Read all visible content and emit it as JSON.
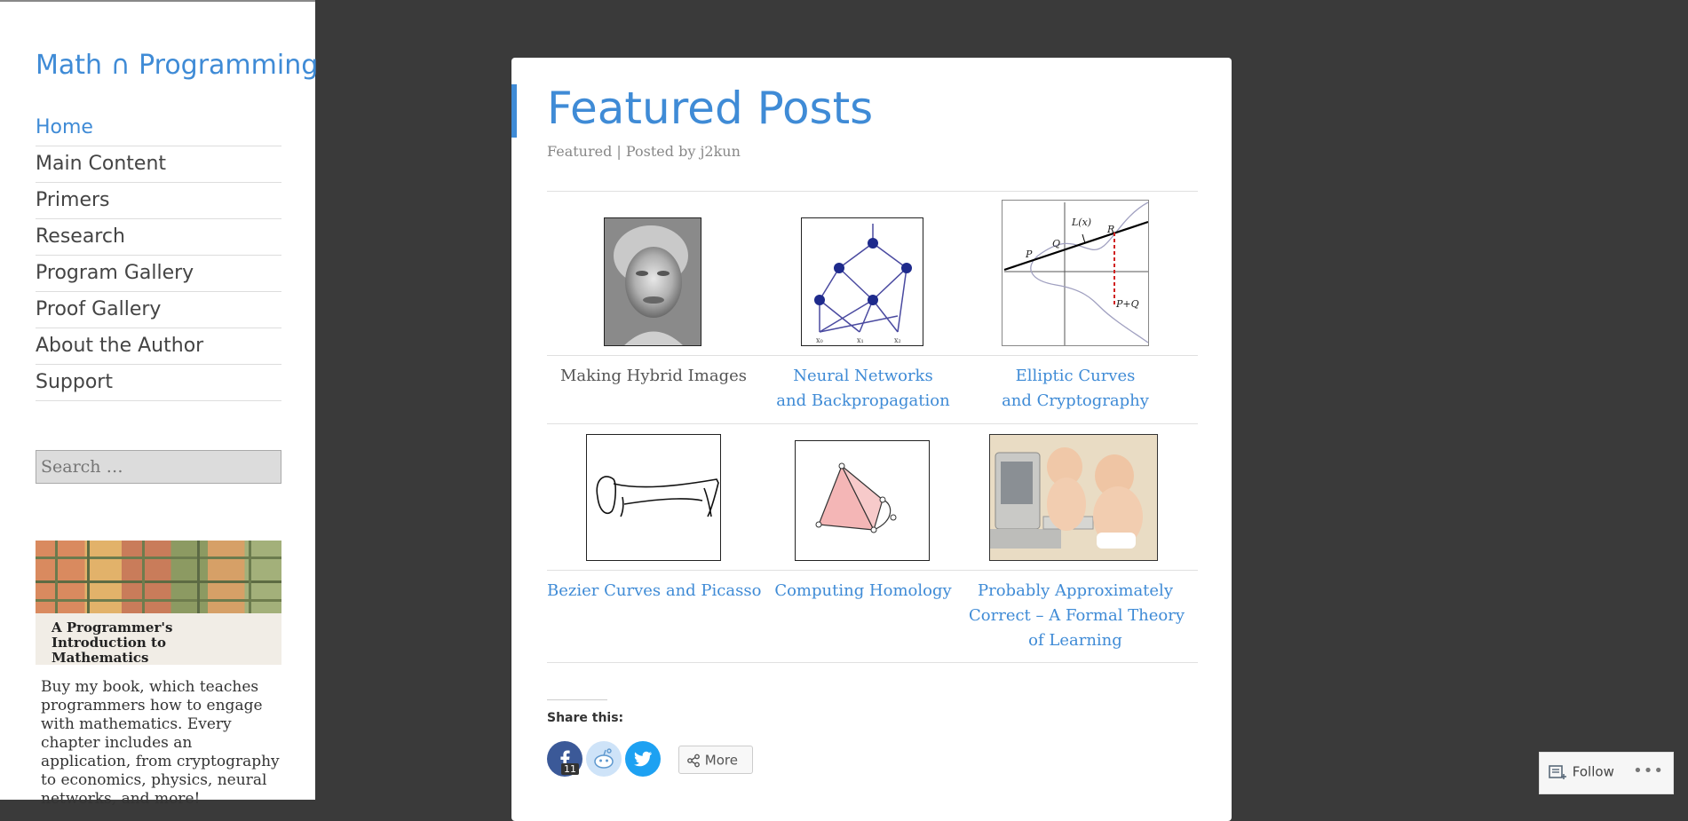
{
  "site": {
    "title": "Math ∩ Programming"
  },
  "nav": {
    "items": [
      {
        "label": "Home"
      },
      {
        "label": "Main Content"
      },
      {
        "label": "Primers"
      },
      {
        "label": "Research"
      },
      {
        "label": "Program Gallery"
      },
      {
        "label": "Proof Gallery"
      },
      {
        "label": "About the Author"
      },
      {
        "label": "Support"
      }
    ]
  },
  "search": {
    "placeholder": "Search …"
  },
  "book": {
    "title": "A Programmer's Introduction to Mathematics",
    "blurb": "Buy my book, which teaches programmers how to engage with mathematics. Every chapter includes an application, from cryptography to economics, physics, neural networks, and more!"
  },
  "page": {
    "title": "Featured Posts",
    "meta": "Featured | Posted by j2kun"
  },
  "featured": [
    {
      "line1": "Making Hybrid Images",
      "line2": "",
      "line3": "",
      "linked": false
    },
    {
      "line1": "Neural Networks",
      "line2": "and Backpropagation",
      "line3": "",
      "linked": true
    },
    {
      "line1": "Elliptic Curves",
      "line2": "and Cryptography",
      "line3": "",
      "linked": true
    },
    {
      "line1": "Bezier Curves and Picasso",
      "line2": "",
      "line3": "",
      "linked": true
    },
    {
      "line1": "Computing Homology",
      "line2": "",
      "line3": "",
      "linked": true
    },
    {
      "line1": "Probably Approximately",
      "line2": "Correct – A Formal Theory",
      "line3": "of Learning",
      "linked": true
    }
  ],
  "elliptic_labels": {
    "lx": "L(x)",
    "p": "P",
    "q": "Q",
    "r": "R",
    "pq": "P+Q"
  },
  "nn_labels": {
    "x0": "x₀",
    "x1": "x₁",
    "x2": "x₂"
  },
  "share": {
    "label": "Share this:",
    "facebook_count": "11",
    "more_label": "More"
  },
  "follow": {
    "label": "Follow",
    "more": "•••"
  },
  "colors": {
    "accent": "#3f8bd6",
    "page_bg": "#3a3a3a",
    "facebook": "#3b5998",
    "twitter": "#1da1f2",
    "reddit": "#cee3f8"
  }
}
